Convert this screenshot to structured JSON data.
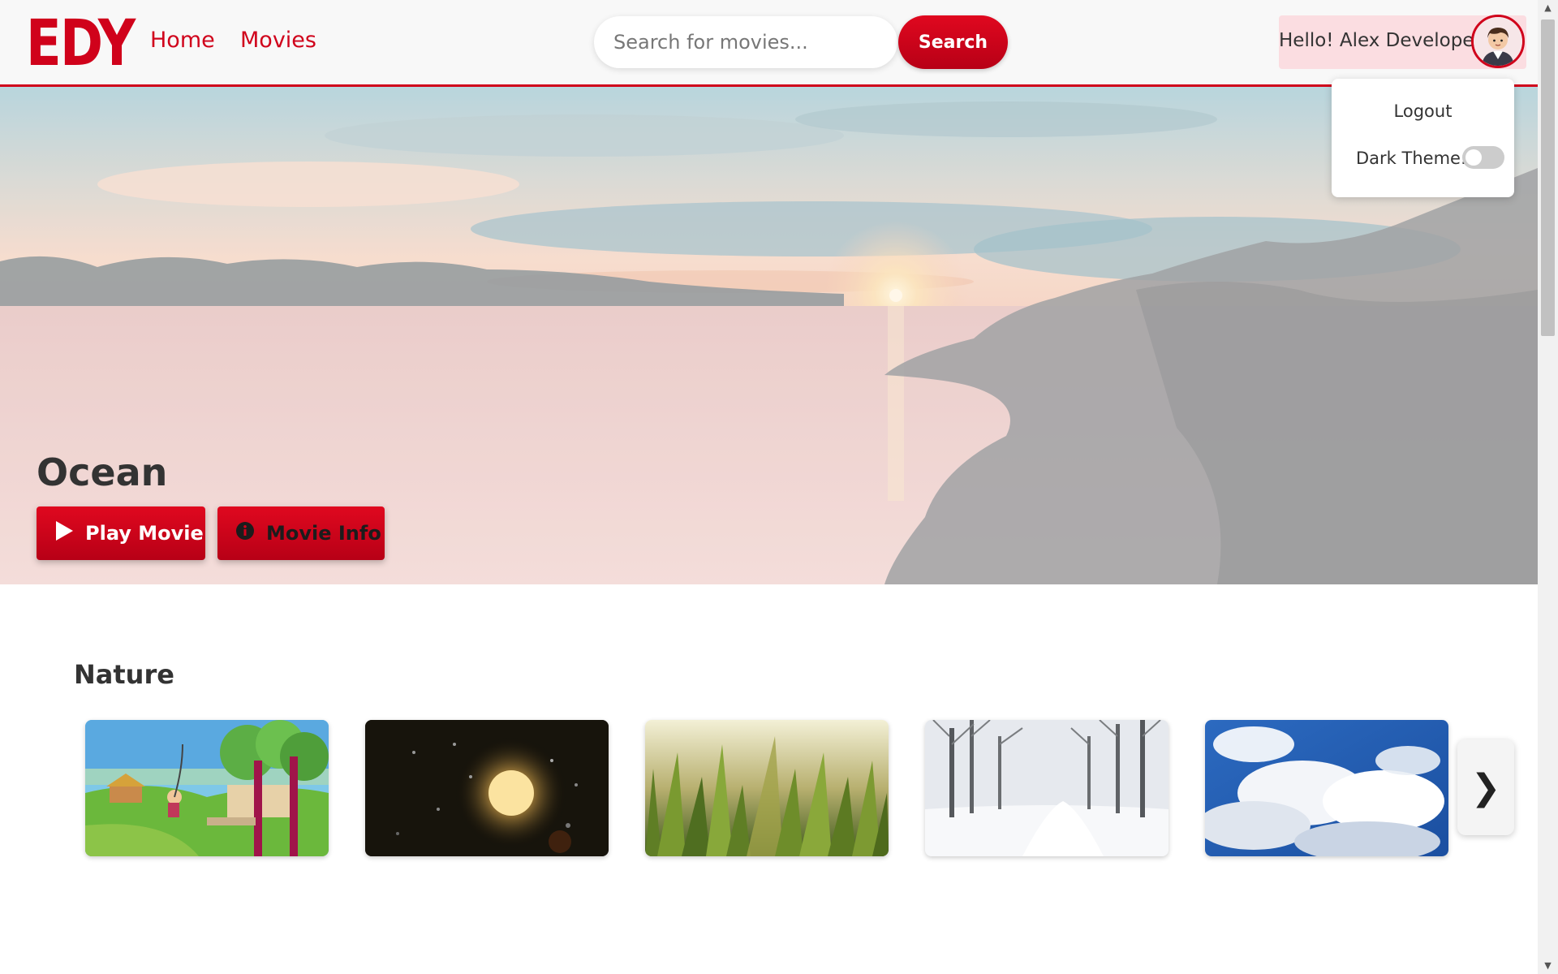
{
  "header": {
    "logo": "EDY",
    "nav": [
      {
        "label": "Home"
      },
      {
        "label": "Movies"
      }
    ],
    "search": {
      "placeholder": "Search for movies...",
      "value": "",
      "button_label": "Search"
    },
    "user": {
      "greeting": "Hello! Alex Developer",
      "avatar_icon": "user-avatar"
    }
  },
  "dropdown": {
    "logout_label": "Logout",
    "dark_theme_label": "Dark Theme:",
    "dark_theme_enabled": false
  },
  "hero": {
    "title": "Ocean",
    "play_label": "Play Movie",
    "info_label": "Movie Info",
    "play_icon": "play-icon",
    "info_icon": "info-icon"
  },
  "rows": [
    {
      "title": "Nature",
      "next_label": "❯",
      "items": [
        {
          "scene": "cartoon-forest"
        },
        {
          "scene": "rain-moon"
        },
        {
          "scene": "grass"
        },
        {
          "scene": "snow-forest"
        },
        {
          "scene": "sky-clouds"
        }
      ]
    }
  ],
  "colors": {
    "accent": "#d0021b",
    "header_bg": "#f8f8f8",
    "user_bg": "#fbdde1"
  }
}
